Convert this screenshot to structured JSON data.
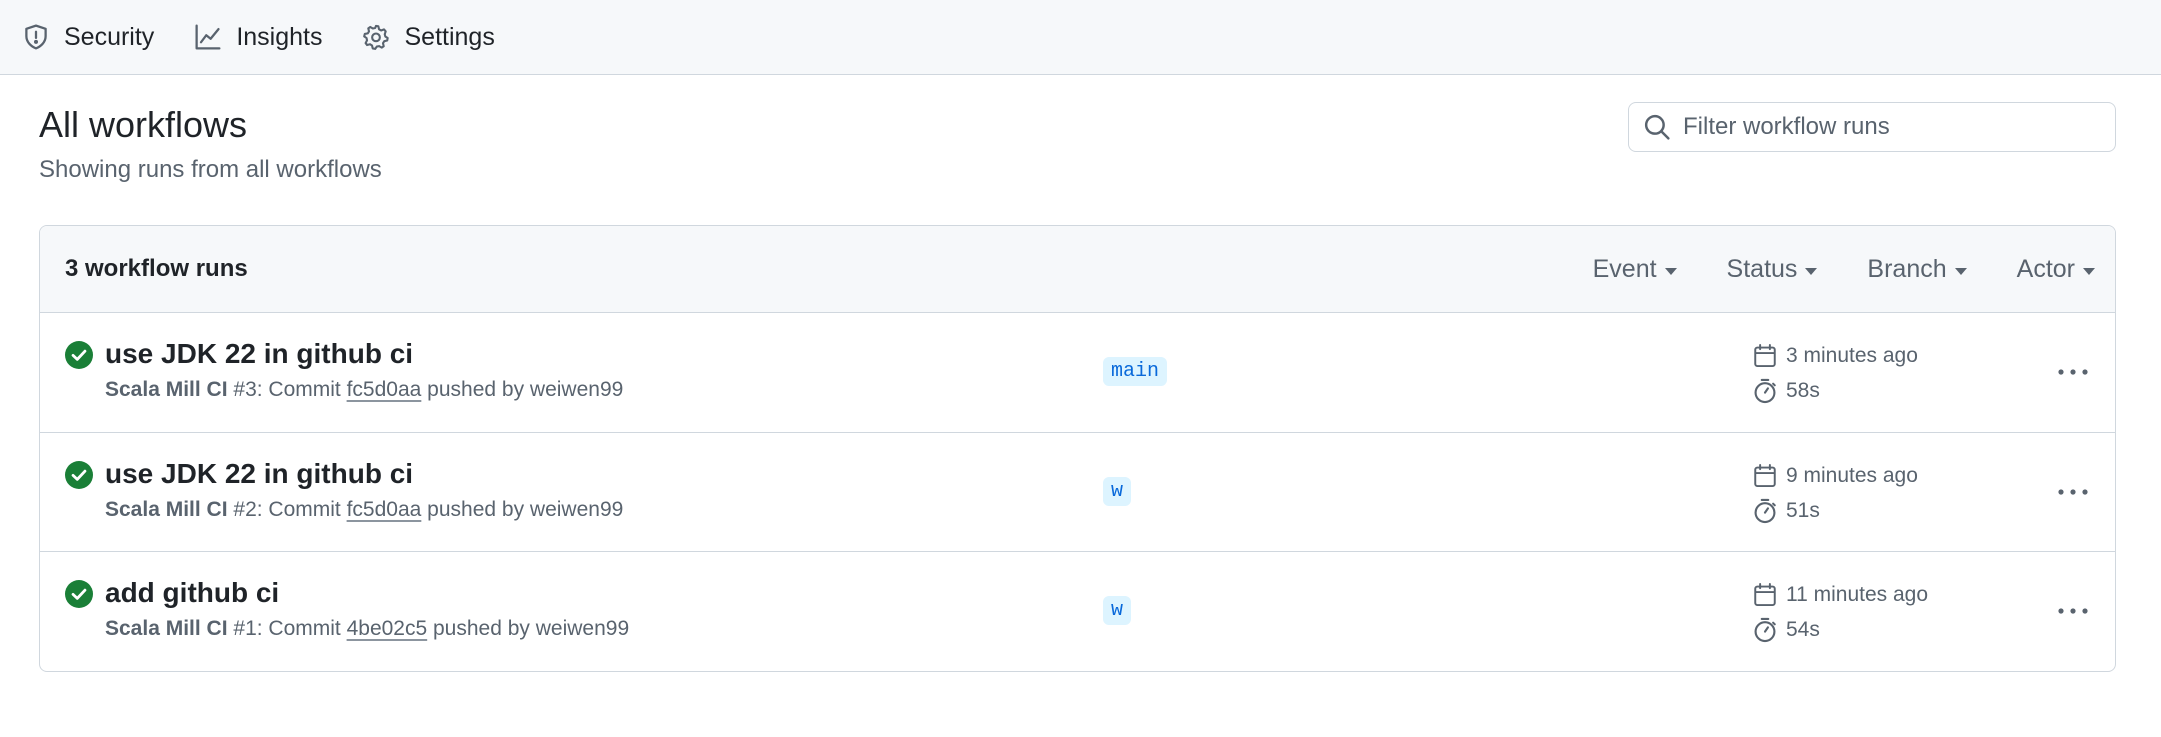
{
  "nav": {
    "items": [
      {
        "label": "Security",
        "icon": "shield-icon"
      },
      {
        "label": "Insights",
        "icon": "graph-icon"
      },
      {
        "label": "Settings",
        "icon": "gear-icon"
      }
    ]
  },
  "header": {
    "title": "All workflows",
    "subtitle": "Showing runs from all workflows"
  },
  "search": {
    "placeholder": "Filter workflow runs",
    "value": ""
  },
  "runs": {
    "count_label": "3 workflow runs",
    "filters": [
      "Event",
      "Status",
      "Branch",
      "Actor"
    ],
    "items": [
      {
        "title": "use JDK 22 in github ci",
        "workflow": "Scala Mill CI",
        "run_number": "#3",
        "commit_prefix": ": Commit ",
        "sha": "fc5d0aa",
        "pushed_by": " pushed by weiwen99",
        "branch": "main",
        "time_ago": "3 minutes ago",
        "duration": "58s",
        "status": "success"
      },
      {
        "title": "use JDK 22 in github ci",
        "workflow": "Scala Mill CI",
        "run_number": "#2",
        "commit_prefix": ": Commit ",
        "sha": "fc5d0aa",
        "pushed_by": " pushed by weiwen99",
        "branch": "w",
        "time_ago": "9 minutes ago",
        "duration": "51s",
        "status": "success"
      },
      {
        "title": "add github ci",
        "workflow": "Scala Mill CI",
        "run_number": "#1",
        "commit_prefix": ": Commit ",
        "sha": "4be02c5",
        "pushed_by": " pushed by weiwen99",
        "branch": "w",
        "time_ago": "11 minutes ago",
        "duration": "54s",
        "status": "success"
      }
    ]
  },
  "colors": {
    "success": "#1a7f37",
    "link": "#0969da",
    "branch_bg": "#ddf4ff",
    "muted": "#59636e"
  }
}
